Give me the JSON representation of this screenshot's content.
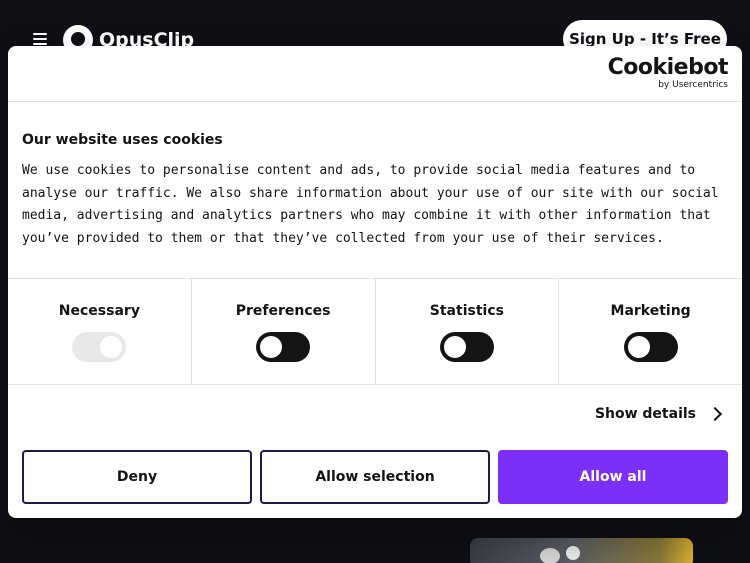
{
  "site": {
    "logo_text": "OpusClip",
    "signup_label": "Sign Up - It’s Free"
  },
  "cookie_dialog": {
    "brand_main": "Cookiebot",
    "brand_sub": "by Usercentrics",
    "title": "Our website uses cookies",
    "body": "We use cookies to personalise content and ads, to provide social media features and to analyse our traffic. We also share information about your use of our site with our social media, advertising and analytics partners who may combine it with other information that you’ve provided to them or that they’ve collected from your use of their services.",
    "categories": [
      {
        "label": "Necessary",
        "enabled": true,
        "disabled": true
      },
      {
        "label": "Preferences",
        "enabled": false
      },
      {
        "label": "Statistics",
        "enabled": false
      },
      {
        "label": "Marketing",
        "enabled": false
      }
    ],
    "show_details_label": "Show details",
    "deny_label": "Deny",
    "allow_selection_label": "Allow selection",
    "allow_all_label": "Allow all"
  },
  "colors": {
    "accent": "#7b2ff7",
    "background": "#0f1016"
  }
}
